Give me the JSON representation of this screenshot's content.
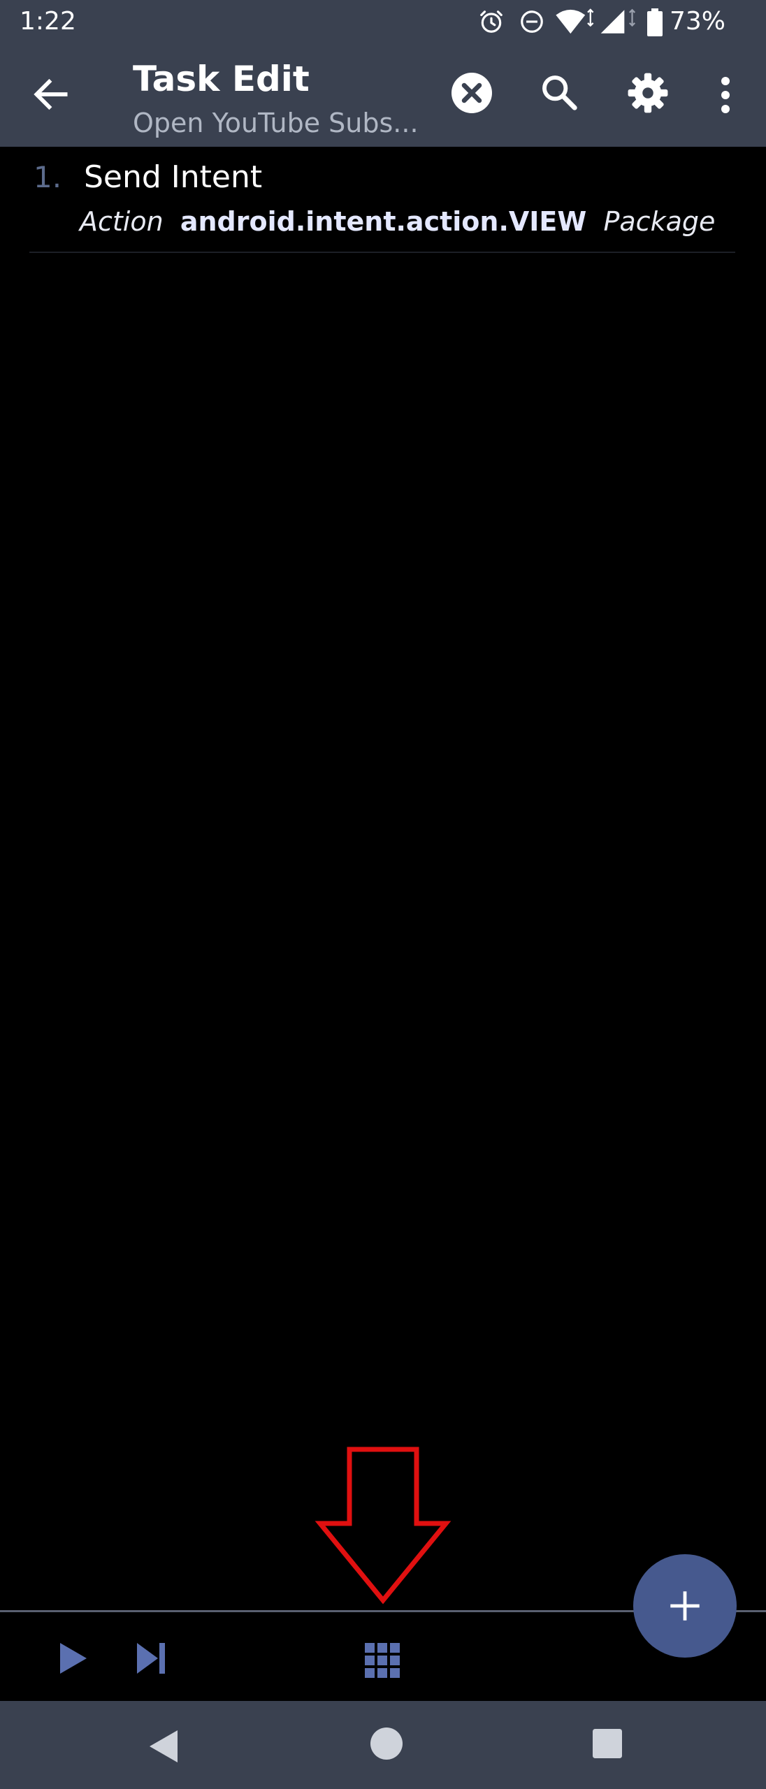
{
  "status_bar": {
    "time": "1:22",
    "battery_percent": "73%",
    "icons": [
      "alarm-icon",
      "dnd-icon",
      "wifi-icon",
      "cell-signal-icon",
      "battery-icon"
    ]
  },
  "app_bar": {
    "title": "Task Edit",
    "subtitle": "Open YouTube Subs...",
    "icons": [
      "back-arrow-icon",
      "clear-icon",
      "search-icon",
      "gear-icon",
      "overflow-menu-icon"
    ]
  },
  "tasks": [
    {
      "number": "1.",
      "name": "Send Intent",
      "action_label": "Action",
      "action_value": "android.intent.action.VIEW",
      "package_label": "Package"
    }
  ],
  "bottom_toolbar": {
    "icons": [
      "play-icon",
      "skip-next-icon",
      "grid-icon"
    ]
  },
  "fab": {
    "icon": "plus-icon"
  },
  "nav_bar": {
    "icons": [
      "nav-back-icon",
      "nav-home-icon",
      "nav-recents-icon"
    ]
  },
  "colors": {
    "bar_background": "#3a4150",
    "fab_background": "#46598e",
    "accent_icon": "#5b70b0",
    "annotation": "#e01010"
  }
}
